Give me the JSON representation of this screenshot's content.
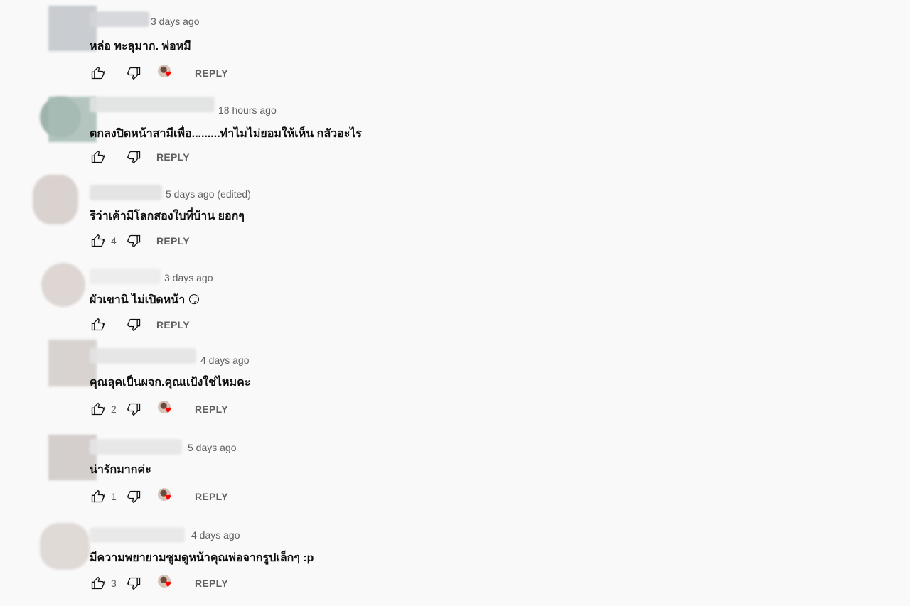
{
  "comments": [
    {
      "time": "3 days ago",
      "text": "หล่อ ทะลุมาก. พ่อหมี",
      "likes": "",
      "hearted": true,
      "reply": "REPLY"
    },
    {
      "time": "18 hours ago",
      "text": "ตกลงปิดหน้าสามีเพื่อ.........ทำไมไม่ยอมให้เห็น กลัวอะไร",
      "likes": "",
      "hearted": false,
      "reply": "REPLY"
    },
    {
      "time": "5 days ago (edited)",
      "text": "รีว่าเค้ามีโลกสองใบที่บ้าน ยอกๆ",
      "likes": "4",
      "hearted": false,
      "reply": "REPLY"
    },
    {
      "time": "3 days ago",
      "text": "ผัวเขานิ ไม่เปิดหน้า 😏",
      "likes": "",
      "hearted": false,
      "reply": "REPLY"
    },
    {
      "time": "4 days ago",
      "text": "คุณลุคเป็นผจก.คุณแป้งใช่ไหมคะ",
      "likes": "2",
      "hearted": true,
      "reply": "REPLY"
    },
    {
      "time": "5 days ago",
      "text": "น่ารักมากค่ะ",
      "likes": "1",
      "hearted": true,
      "reply": "REPLY"
    },
    {
      "time": "4 days ago",
      "text": "มีความพยายามซูมดูหน้าคุณพ่อจากรูปเล็กๆ :p",
      "likes": "3",
      "hearted": true,
      "reply": "REPLY"
    }
  ],
  "colors": {
    "heart": "#ff0000",
    "meta_text": "#606060",
    "background": "#f9f9f9"
  }
}
